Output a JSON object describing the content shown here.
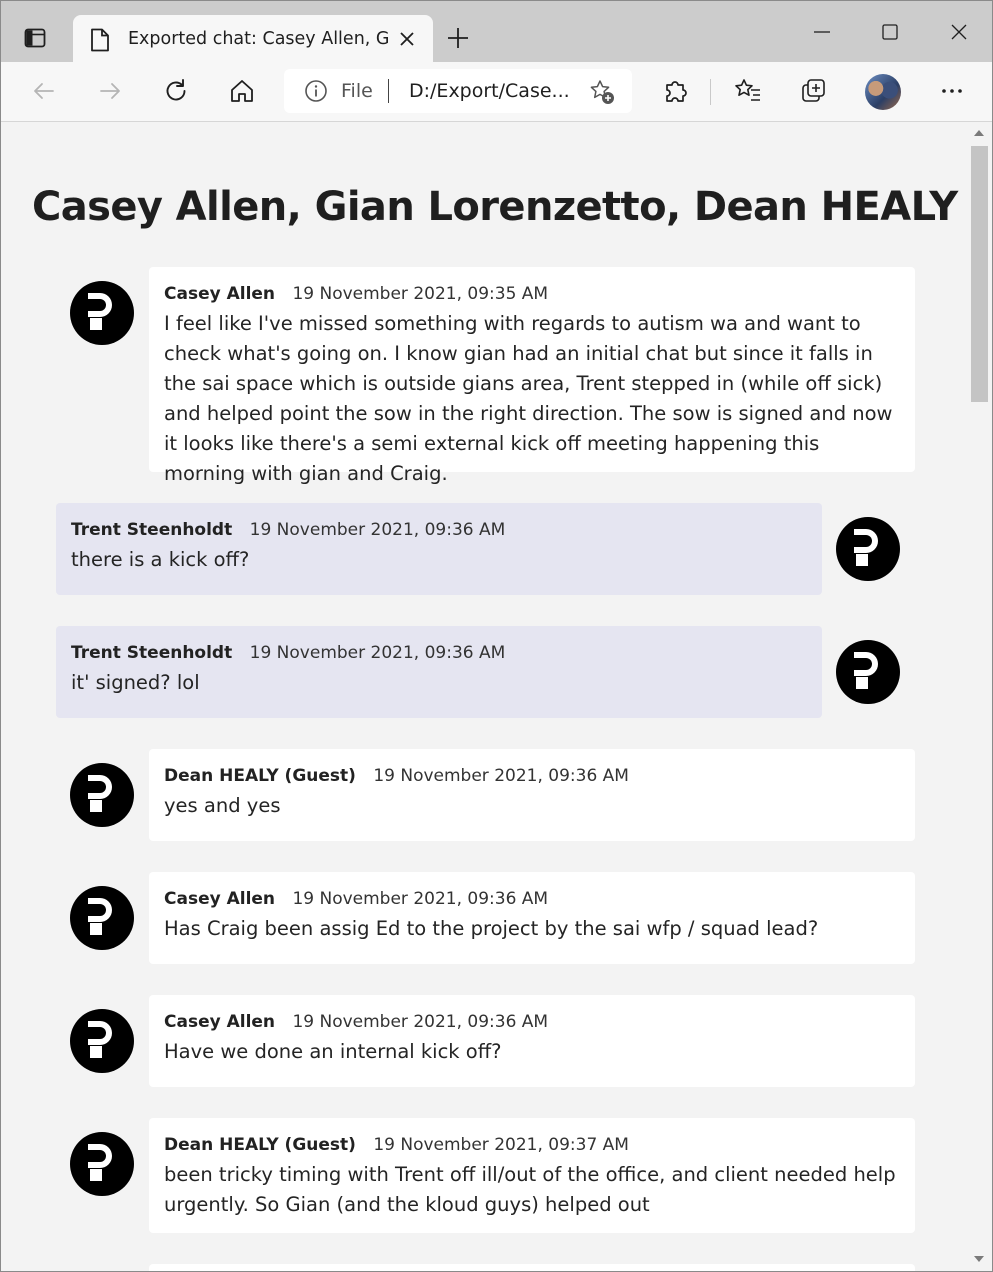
{
  "browser": {
    "tab_title": "Exported chat: Casey Allen, Gian",
    "address_prefix": "File",
    "address_url": "D:/Export/Case..."
  },
  "page": {
    "title": "Casey Allen, Gian Lorenzetto, Dean HEALY"
  },
  "messages": [
    {
      "sender": "Casey Allen",
      "time": "19 November 2021, 09:35 AM",
      "text": "I feel like I've missed something with regards to autism wa and want to check what's going on. I know gian had an initial chat but since it falls in the sai space which is outside gians area, Trent stepped in (while off sick) and helped point the sow in the right direction. The sow is signed and now it looks like there's a semi external kick off meeting happening this morning with gian and Craig.",
      "side": "left"
    },
    {
      "sender": "Trent Steenholdt",
      "time": "19 November 2021, 09:36 AM",
      "text": "there is a kick off?",
      "side": "right"
    },
    {
      "sender": "Trent Steenholdt",
      "time": "19 November 2021, 09:36 AM",
      "text": "it' signed? lol",
      "side": "right"
    },
    {
      "sender": "Dean HEALY (Guest)",
      "time": "19 November 2021, 09:36 AM",
      "text": "yes and yes",
      "side": "left"
    },
    {
      "sender": "Casey Allen",
      "time": "19 November 2021, 09:36 AM",
      "text": "Has Craig been assig Ed to the project by the sai wfp / squad lead?",
      "side": "left"
    },
    {
      "sender": "Casey Allen",
      "time": "19 November 2021, 09:36 AM",
      "text": "Have we done an internal kick off?",
      "side": "left"
    },
    {
      "sender": "Dean HEALY (Guest)",
      "time": "19 November 2021, 09:37 AM",
      "text": "been tricky timing with Trent off ill/out of the office, and client needed help urgently. So Gian (and the kloud guys) helped out",
      "side": "left"
    }
  ],
  "icons": {
    "tab_actions": "tab-actions-icon",
    "favicon": "document-icon",
    "close": "close-icon",
    "new_tab": "plus-icon",
    "back": "arrow-left-icon",
    "forward": "arrow-right-icon",
    "refresh": "refresh-icon",
    "home": "home-icon",
    "info": "info-icon",
    "add_favorite": "star-plus-icon",
    "extensions": "puzzle-icon",
    "favorites": "favorites-list-icon",
    "collections": "collections-icon",
    "more": "ellipsis-icon"
  },
  "colors": {
    "titlebar": "#cccccc",
    "toolbar": "#f7f7f7",
    "page_background": "#f3f3f3",
    "self_bubble": "#e5e5f1",
    "other_bubble": "#ffffff"
  }
}
